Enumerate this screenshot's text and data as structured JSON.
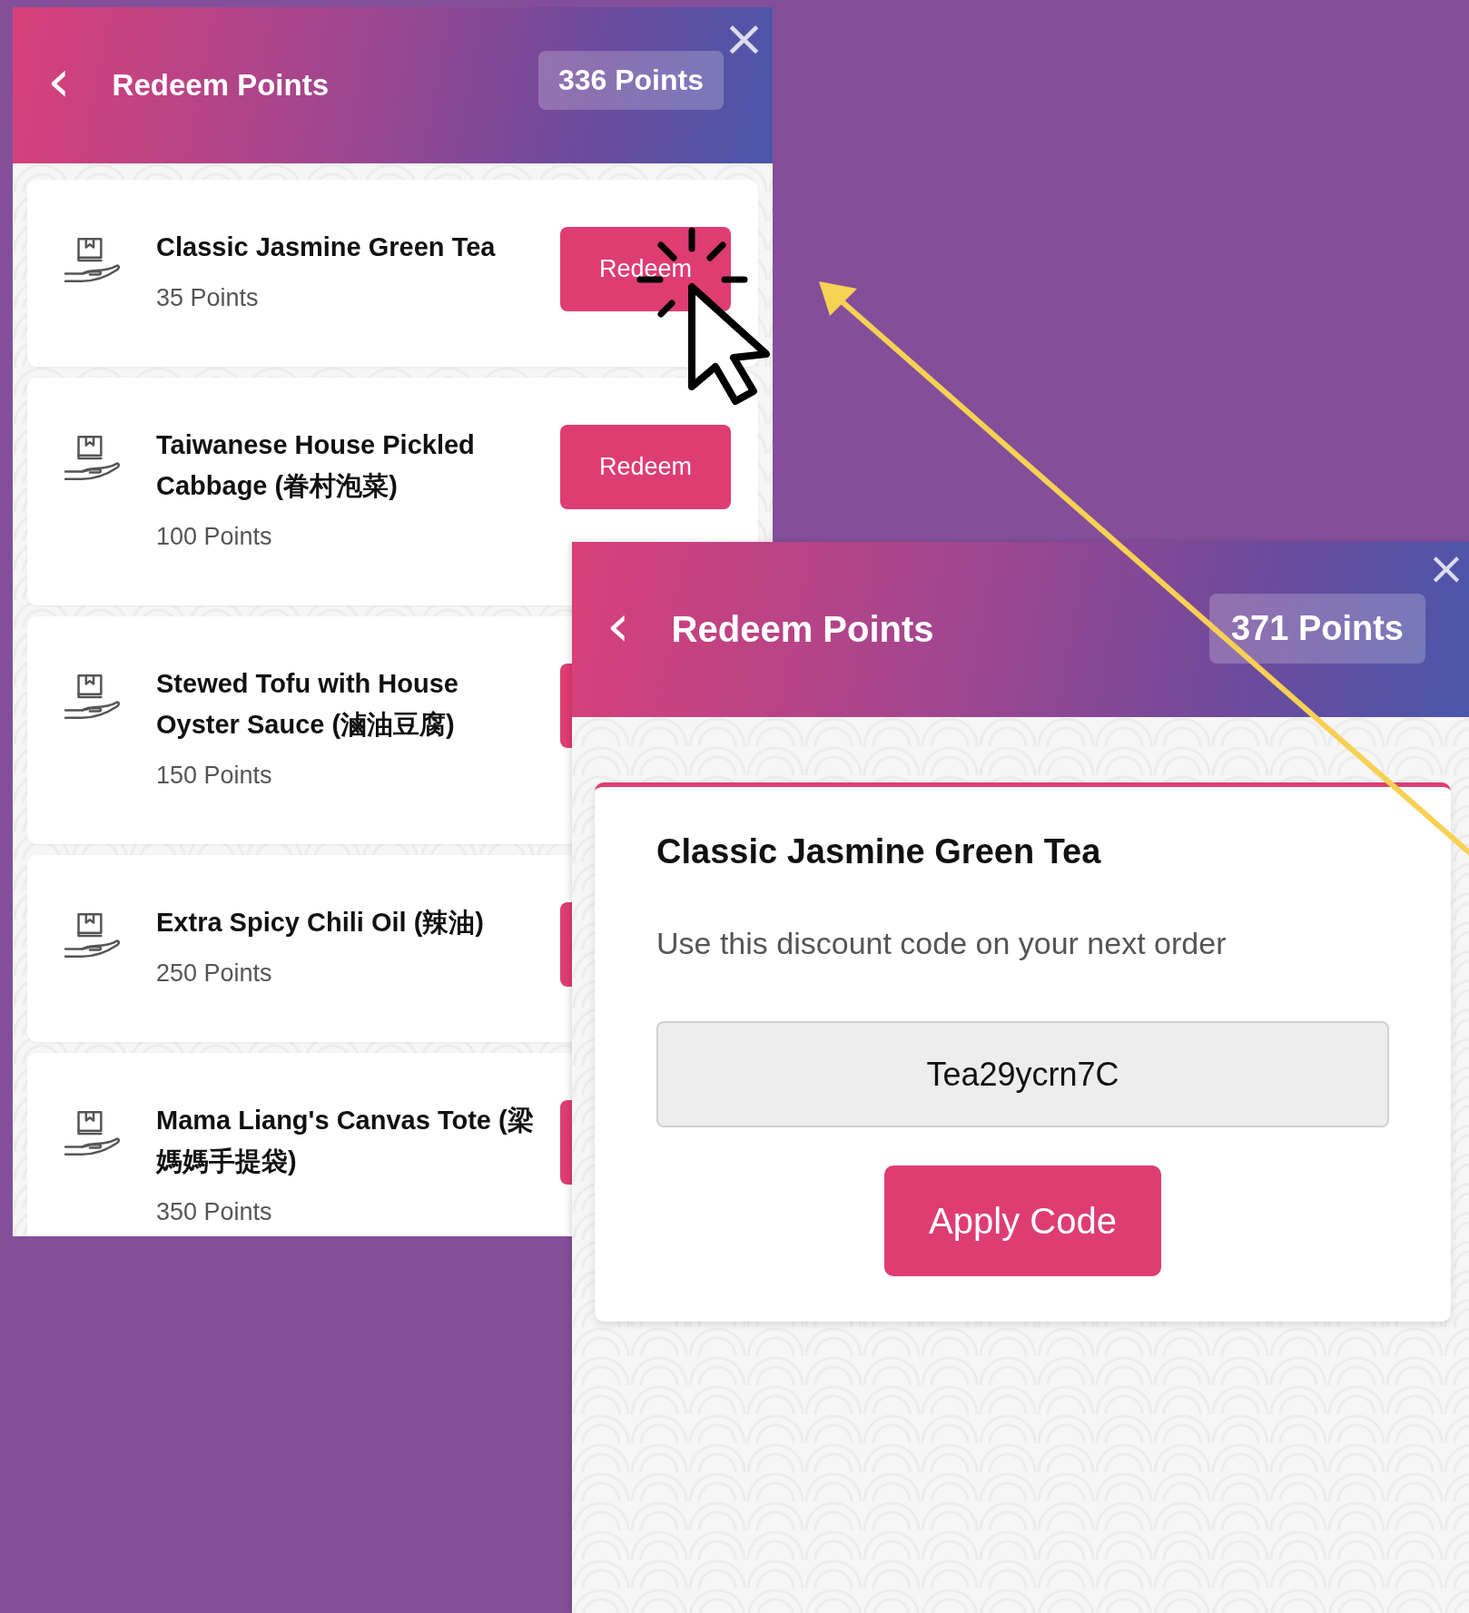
{
  "list_screen": {
    "back": "‹",
    "title": "Redeem Points",
    "points": "336 Points",
    "close": "×",
    "items": [
      {
        "name": "Classic Jasmine Green Tea",
        "points": "35 Points",
        "button": "Redeem"
      },
      {
        "name": "Taiwanese House Pickled Cabbage (眷村泡菜)",
        "points": "100 Points",
        "button": "Redeem"
      },
      {
        "name": "Stewed Tofu with House Oyster Sauce (滷油豆腐)",
        "points": "150 Points"
      },
      {
        "name": "Extra Spicy Chili Oil (辣油)",
        "points": "250 Points"
      },
      {
        "name": "Mama Liang's Canvas Tote (梁媽媽手提袋)",
        "points": "350 Points"
      }
    ]
  },
  "code_screen": {
    "back": "‹",
    "title": "Redeem Points",
    "points": "371 Points",
    "close": "×",
    "card": {
      "title": "Classic Jasmine Green Tea",
      "message": "Use this discount code on your next order",
      "code": "Tea29ycrn7C",
      "button": "Apply Code"
    }
  }
}
